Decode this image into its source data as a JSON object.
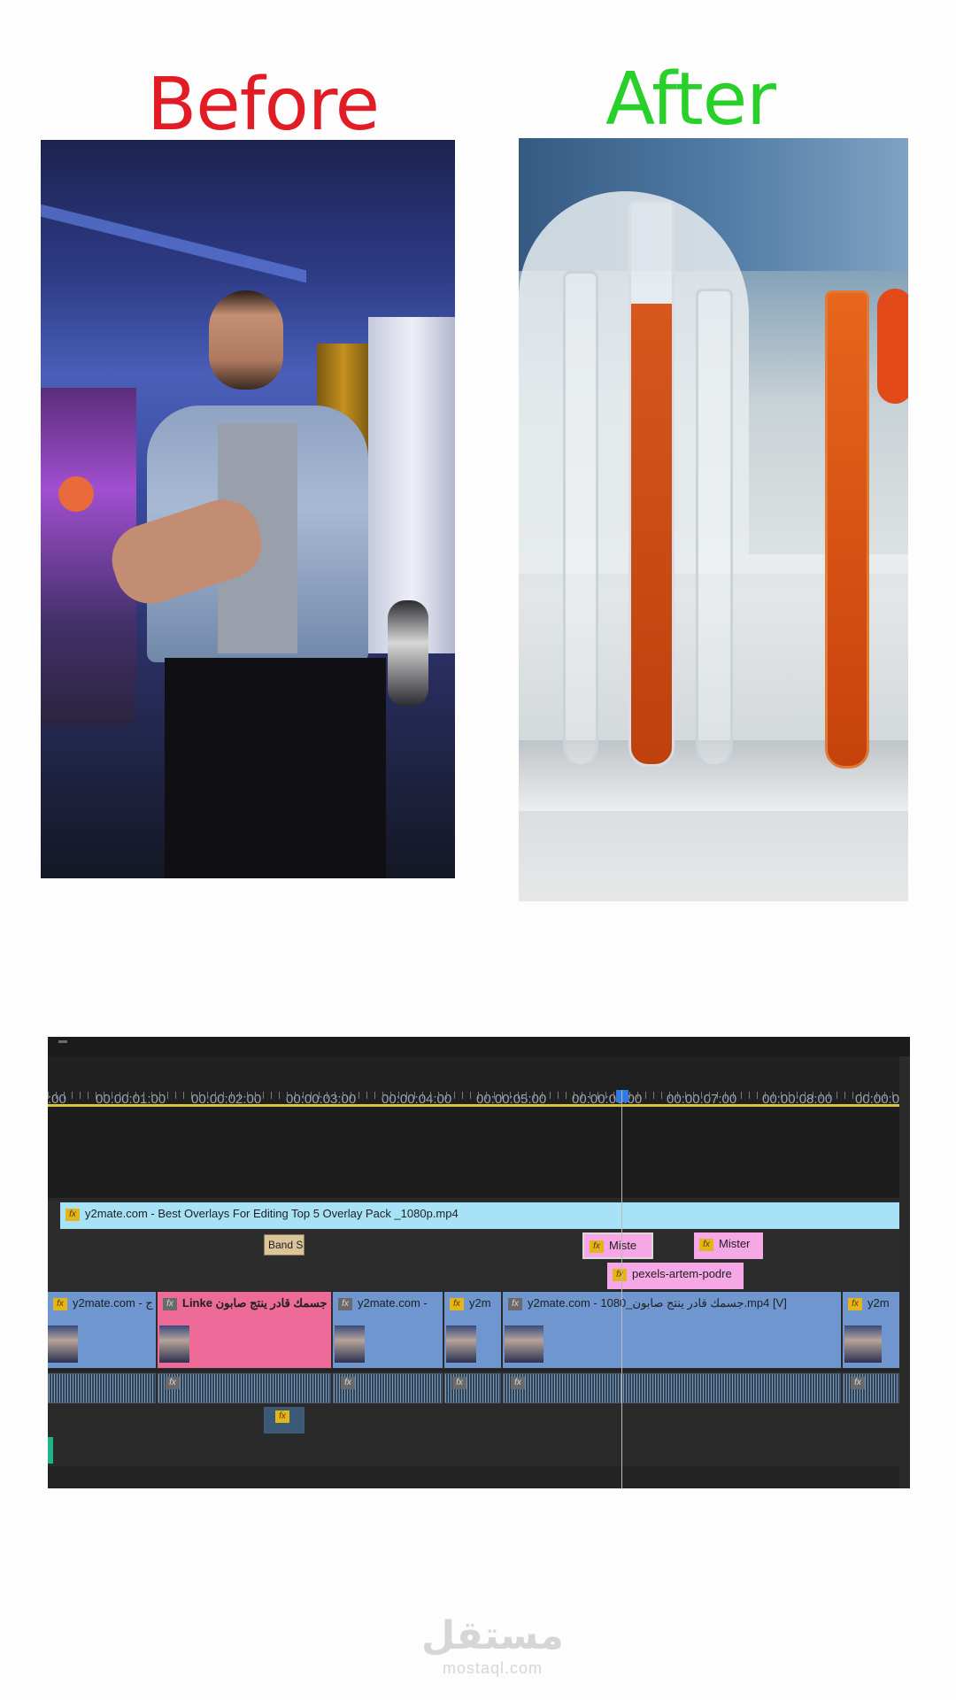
{
  "headings": {
    "before": "Before",
    "after": "After"
  },
  "colors": {
    "before": "#e21c24",
    "after": "#2ad02a",
    "video_clip": "#6f96cf",
    "selected_clip": "#ee6a98",
    "overlay_clip": "#a7e2f7",
    "title_clip": "#f5a7e6",
    "playhead": "#2f7ae6"
  },
  "timeline": {
    "timecodes": [
      ":00",
      "00:00:01:00",
      "00:00:02:00",
      "00:00:03:00",
      "00:00:04:00",
      "00:00:05:00",
      "00:00:06:00",
      "00:00:07:00",
      "00:00:08:00",
      "00:00:0"
    ],
    "overlay_clip": "y2mate.com - Best Overlays For Editing  Top 5 Overlay Pack  _1080p.mp4",
    "band_clip": "Band S",
    "title_clips": [
      "Miste",
      "Mister"
    ],
    "pexels_clip": "pexels-artem-podre",
    "video_clips": [
      "y2mate.com - ج",
      "Linke جسمك قادر ينتج صابون",
      "y2mate.com -",
      "y2m",
      "y2mate.com - 1080_جسمك قادر ينتج صابون.mp4 [V]",
      "y2m"
    ],
    "fx_label": "fx"
  },
  "watermark": {
    "arabic": "مستقل",
    "latin": "mostaql.com"
  }
}
